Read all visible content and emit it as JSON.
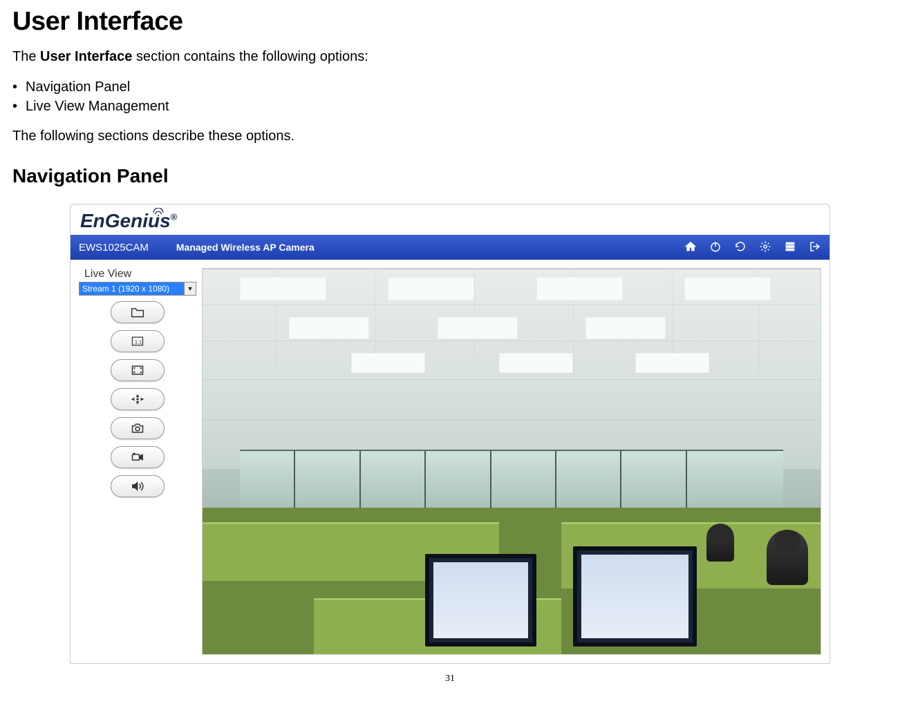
{
  "doc": {
    "title": "User Interface",
    "intro_prefix": "The ",
    "intro_bold": "User Interface",
    "intro_suffix": " section contains the following options:",
    "bullets": [
      "Navigation Panel",
      "Live View Management"
    ],
    "desc": "The following sections describe these options.",
    "subheading": "Navigation Panel",
    "page_number": "31"
  },
  "app": {
    "brand": "EnGenius",
    "brand_reg": "®",
    "model": "EWS1025CAM",
    "subtitle": "Managed Wireless AP Camera",
    "nav_icons": [
      "home",
      "power",
      "refresh",
      "settings",
      "stack",
      "logout"
    ],
    "live_view_label": "Live View",
    "stream_selected": "Stream 1 (1920 x 1080)",
    "tool_buttons": [
      "folder",
      "actual-size",
      "fullscreen",
      "ptz",
      "snapshot",
      "record",
      "audio"
    ]
  }
}
